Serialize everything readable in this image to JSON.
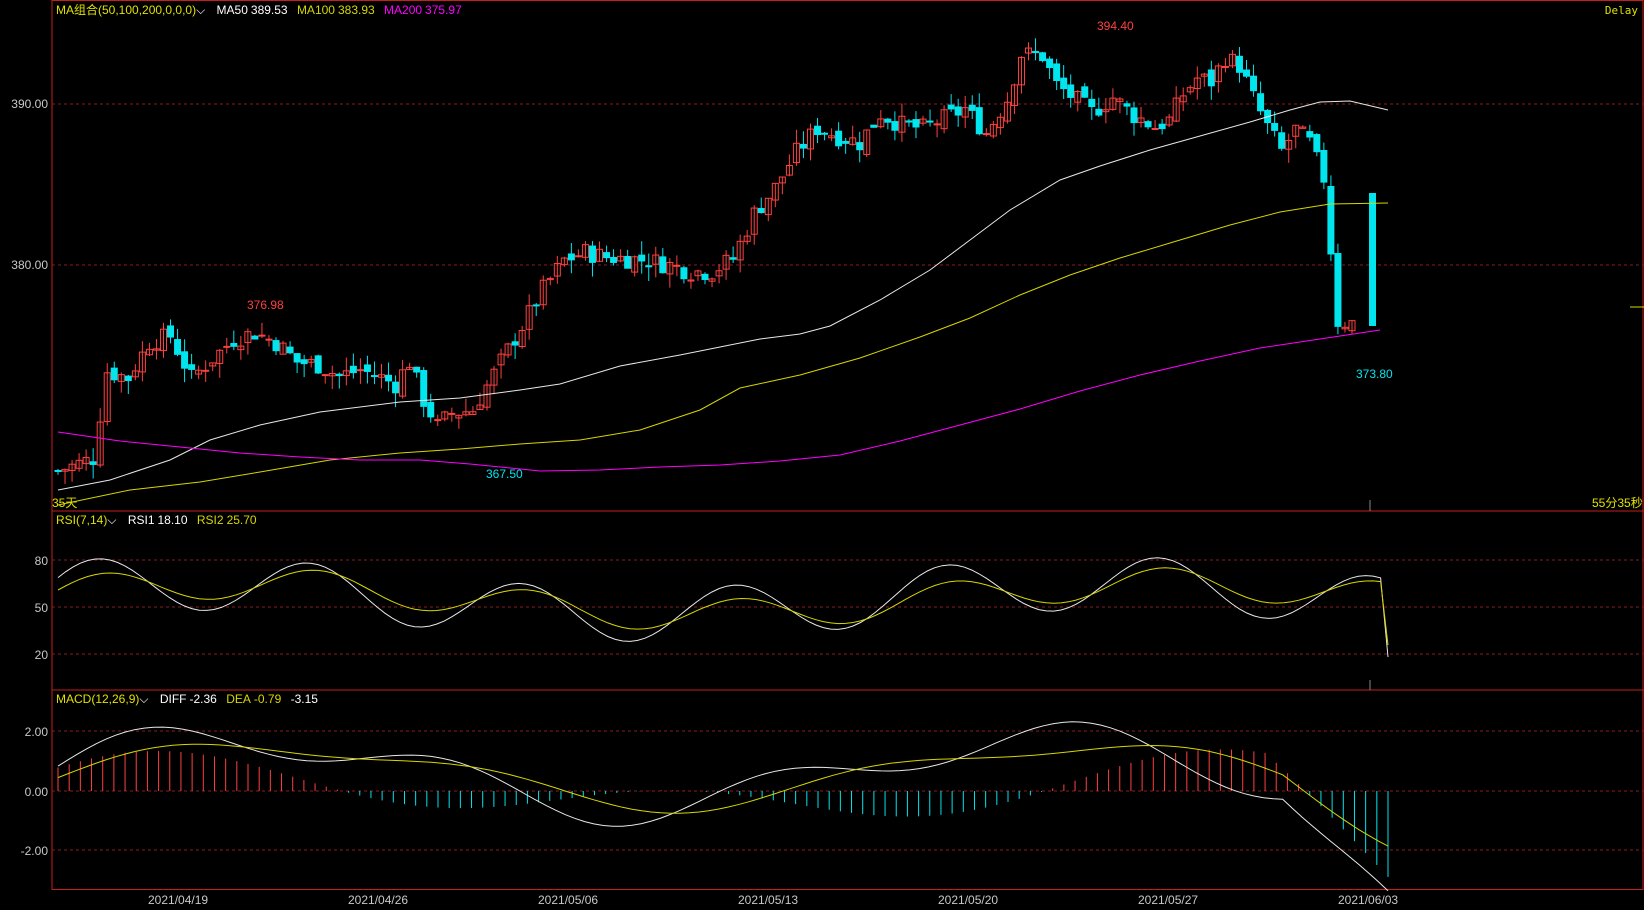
{
  "colors": {
    "background": "#000000",
    "frame": "#c81e1e",
    "grid": "#8a1e1e",
    "up": "#ff4040",
    "down": "#00e5ee",
    "ma50": "#e8e8e8",
    "ma100": "#d6d600",
    "ma200": "#ff00ff",
    "text_label": "#e0e000",
    "text_value": "#ffffff"
  },
  "status": {
    "delay": "Delay",
    "timer": "55分35秒",
    "period": "35天"
  },
  "main_legend": {
    "name": "MA组合(50,100,200,0,0,0)",
    "ma50_label": "MA50",
    "ma50_value": "389.53",
    "ma100_label": "MA100",
    "ma100_value": "383.93",
    "ma200_label": "MA200",
    "ma200_value": "375.97"
  },
  "rsi_legend": {
    "name": "RSI(7,14)",
    "rsi1_label": "RSI1",
    "rsi1_value": "18.10",
    "rsi2_label": "RSI2",
    "rsi2_value": "25.70"
  },
  "macd_legend": {
    "name": "MACD(12,26,9)",
    "diff_label": "DIFF",
    "diff_value": "-2.36",
    "dea_label": "DEA",
    "dea_value": "-0.79",
    "macd_value": "-3.15"
  },
  "price_axis": [
    "390.00",
    "380.00"
  ],
  "rsi_axis": [
    "80",
    "50",
    "20"
  ],
  "macd_axis": [
    "2.00",
    "0.00",
    "-2.00"
  ],
  "dates": [
    "2021/04/19",
    "2021/04/26",
    "2021/05/06",
    "2021/05/13",
    "2021/05/20",
    "2021/05/27",
    "2021/06/03"
  ],
  "annotations": {
    "high1": "376.98",
    "low1": "367.50",
    "high2": "394.40",
    "low2": "373.80"
  },
  "chart_data": {
    "type": "candlestick",
    "price_range": [
      365.0,
      396.5
    ],
    "ma_series": [
      {
        "name": "MA50",
        "current": 389.53
      },
      {
        "name": "MA100",
        "current": 383.93
      },
      {
        "name": "MA200",
        "current": 375.97
      }
    ],
    "rsi": {
      "rsi1": 18.1,
      "rsi2": 25.7,
      "range": [
        5,
        100
      ]
    },
    "macd": {
      "diff": -2.36,
      "dea": -0.79,
      "macd": -3.15,
      "range": [
        -3.2,
        2.8
      ]
    }
  },
  "icons": {
    "dropdown": "chevron-down-icon"
  }
}
